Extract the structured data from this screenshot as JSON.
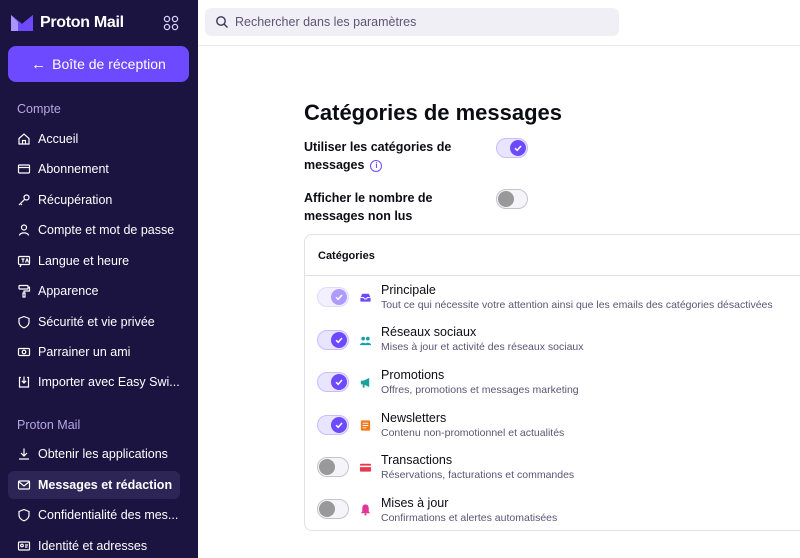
{
  "sidebar": {
    "brand": "Proton Mail",
    "inbox_button": "Boîte de réception",
    "sections": [
      {
        "title": "Compte",
        "items": [
          {
            "label": "Accueil",
            "icon": "home-icon"
          },
          {
            "label": "Abonnement",
            "icon": "credit-card-icon"
          },
          {
            "label": "Récupération",
            "icon": "key-icon"
          },
          {
            "label": "Compte et mot de passe",
            "icon": "user-icon"
          },
          {
            "label": "Langue et heure",
            "icon": "language-icon"
          },
          {
            "label": "Apparence",
            "icon": "paint-roller-icon"
          },
          {
            "label": "Sécurité et vie privée",
            "icon": "shield-icon"
          },
          {
            "label": "Parrainer un ami",
            "icon": "money-icon"
          },
          {
            "label": "Importer avec Easy Swi...",
            "icon": "import-icon"
          }
        ]
      },
      {
        "title": "Proton Mail",
        "items": [
          {
            "label": "Obtenir les applications",
            "icon": "download-icon"
          },
          {
            "label": "Messages et rédaction",
            "icon": "envelope-icon",
            "active": true
          },
          {
            "label": "Confidentialité des mes...",
            "icon": "shield-icon"
          },
          {
            "label": "Identité et adresses",
            "icon": "id-card-icon"
          }
        ]
      }
    ]
  },
  "search": {
    "placeholder": "Rechercher dans les paramètres"
  },
  "main": {
    "title": "Catégories de messages",
    "settings": [
      {
        "label": "Utiliser les catégories de messages",
        "enabled": true
      },
      {
        "label": "Afficher le nombre de messages non lus",
        "enabled": false
      }
    ],
    "card_header": "Catégories",
    "categories": [
      {
        "name": "Principale",
        "desc": "Tout ce qui nécessite votre attention ainsi que les emails des catégories désactivées",
        "enabled": true,
        "disabled": true,
        "icon": "inbox-icon",
        "color": "#6d4aff"
      },
      {
        "name": "Réseaux sociaux",
        "desc": "Mises à jour et activité des réseaux sociaux",
        "enabled": true,
        "icon": "users-icon",
        "color": "#1aa0a8"
      },
      {
        "name": "Promotions",
        "desc": "Offres, promotions et messages marketing",
        "enabled": true,
        "icon": "megaphone-icon",
        "color": "#1aa39c"
      },
      {
        "name": "Newsletters",
        "desc": "Contenu non-promotionnel et actualités",
        "enabled": true,
        "icon": "newspaper-icon",
        "color": "#f0791b"
      },
      {
        "name": "Transactions",
        "desc": "Réservations, facturations et commandes",
        "enabled": false,
        "icon": "credit-card-icon",
        "color": "#e8384f"
      },
      {
        "name": "Mises à jour",
        "desc": "Confirmations et alertes automatisées",
        "enabled": false,
        "icon": "bell-icon",
        "color": "#e0389a"
      }
    ]
  },
  "colors": {
    "accent": "#6d4aff",
    "sidebar_bg": "#1b1340"
  }
}
